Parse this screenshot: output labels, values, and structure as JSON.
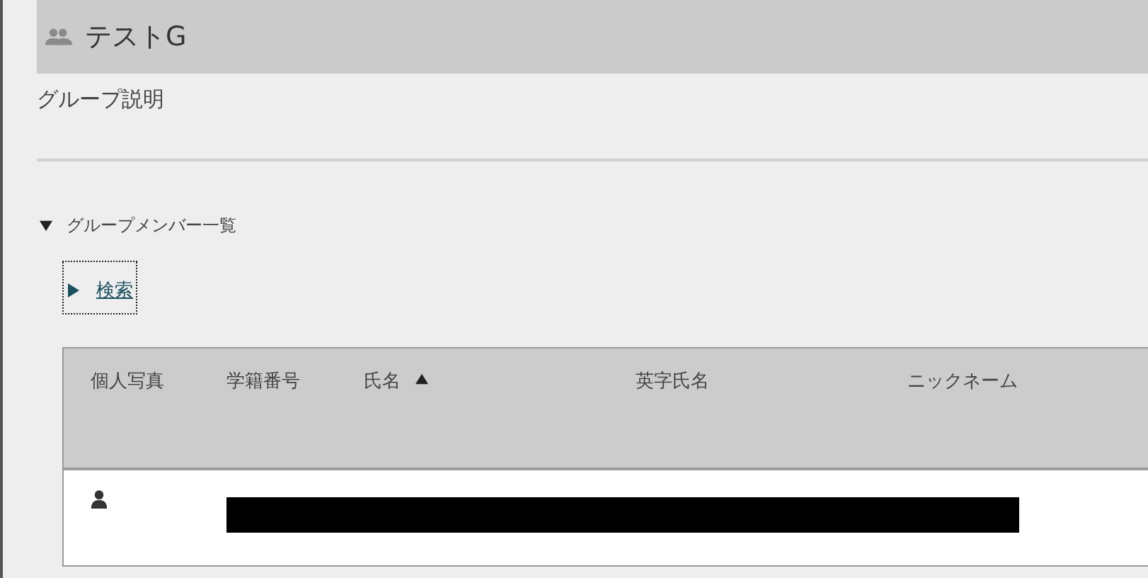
{
  "group": {
    "title": "テストG",
    "description_label": "グループ説明"
  },
  "members_section": {
    "title": "グループメンバー一覧",
    "expanded": true
  },
  "search_toggle": {
    "label": "検索",
    "expanded": false
  },
  "table": {
    "columns": [
      {
        "label": "個人写真",
        "sorted": false
      },
      {
        "label": "学籍番号",
        "sorted": false
      },
      {
        "label": "氏名",
        "sorted": true
      },
      {
        "label": "英字氏名",
        "sorted": false
      },
      {
        "label": "ニックネーム",
        "sorted": false
      }
    ],
    "rows": [
      {
        "redacted": true
      }
    ]
  }
}
